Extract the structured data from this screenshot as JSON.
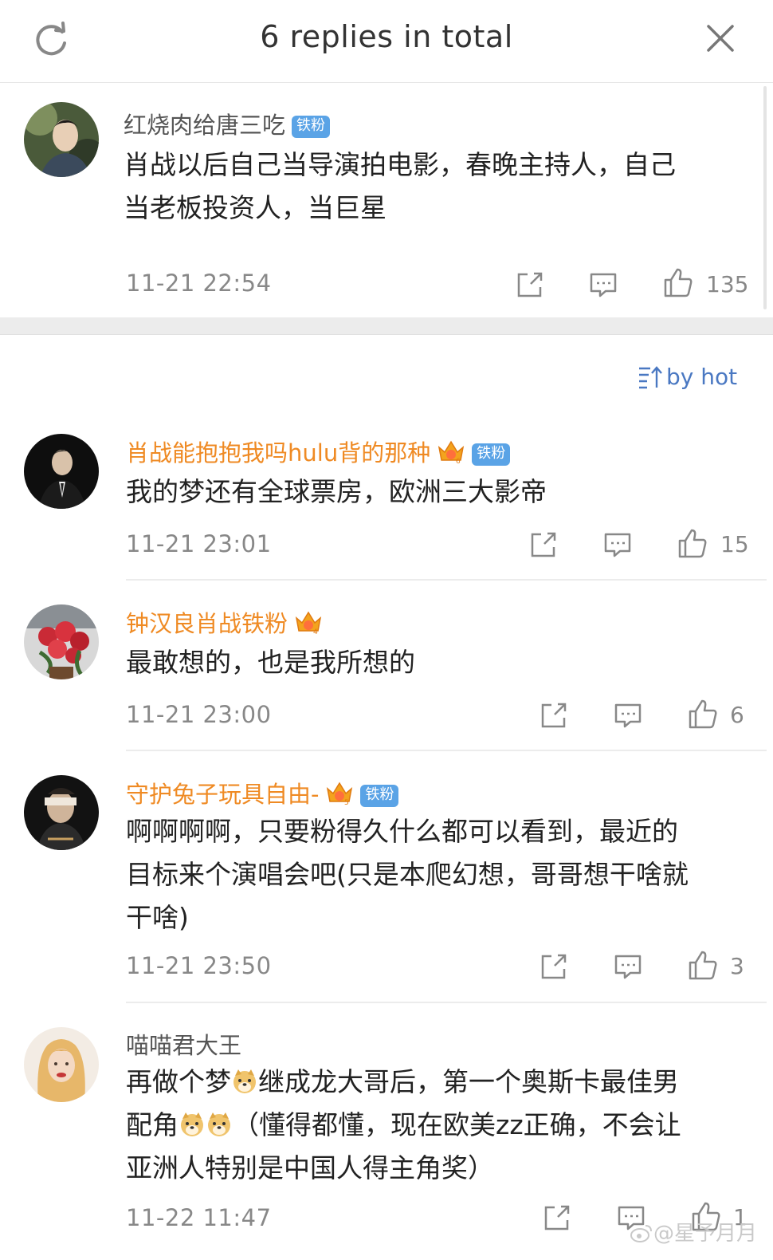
{
  "header": {
    "title": "6 replies in total",
    "refresh_icon": "refresh-icon",
    "close_icon": "close-icon"
  },
  "root_comment": {
    "username": "红烧肉给唐三吃",
    "badge": "铁粉",
    "text_line1": "肖战以后自己当导演拍电影，春晚主持人，自己",
    "text_line2": "当老板投资人，当巨星",
    "time": "11-21 22:54",
    "likes": "135"
  },
  "sort": {
    "label": "by hot"
  },
  "replies": [
    {
      "username": "肖战能抱抱我吗hulu背的那种",
      "crown_level": "6",
      "badge": "铁粉",
      "text_line1": "我的梦还有全球票房，欧洲三大影帝",
      "time": "11-21 23:01",
      "likes": "15"
    },
    {
      "username": "钟汉良肖战铁粉",
      "crown_level": "4",
      "text_line1": "最敢想的，也是我所想的",
      "time": "11-21 23:00",
      "likes": "6"
    },
    {
      "username": "守护兔子玩具自由-",
      "crown_level": "5",
      "badge": "铁粉",
      "text_line1": "啊啊啊啊，只要粉得久什么都可以看到，最近的",
      "text_line2": "目标来个演唱会吧(只是本爬幻想，哥哥想干啥就",
      "text_line3": "干啥)",
      "time": "11-21 23:50",
      "likes": "3"
    },
    {
      "username": "喵喵君大王",
      "text_line1a": "再做个梦",
      "text_line1b": "继成龙大哥后，第一个奥斯卡最佳男",
      "text_line2a": "配角",
      "text_line2b": "（懂得都懂，现在欧美zz正确，不会让",
      "text_line3": "亚洲人特别是中国人得主角奖）",
      "time": "11-22 11:47",
      "likes": "1"
    }
  ],
  "watermark": "@星予月月",
  "colors": {
    "orange_name": "#ef8a23",
    "badge_blue": "#5aa3e6",
    "link_blue": "#4a78c2",
    "meta_gray": "#888888"
  }
}
